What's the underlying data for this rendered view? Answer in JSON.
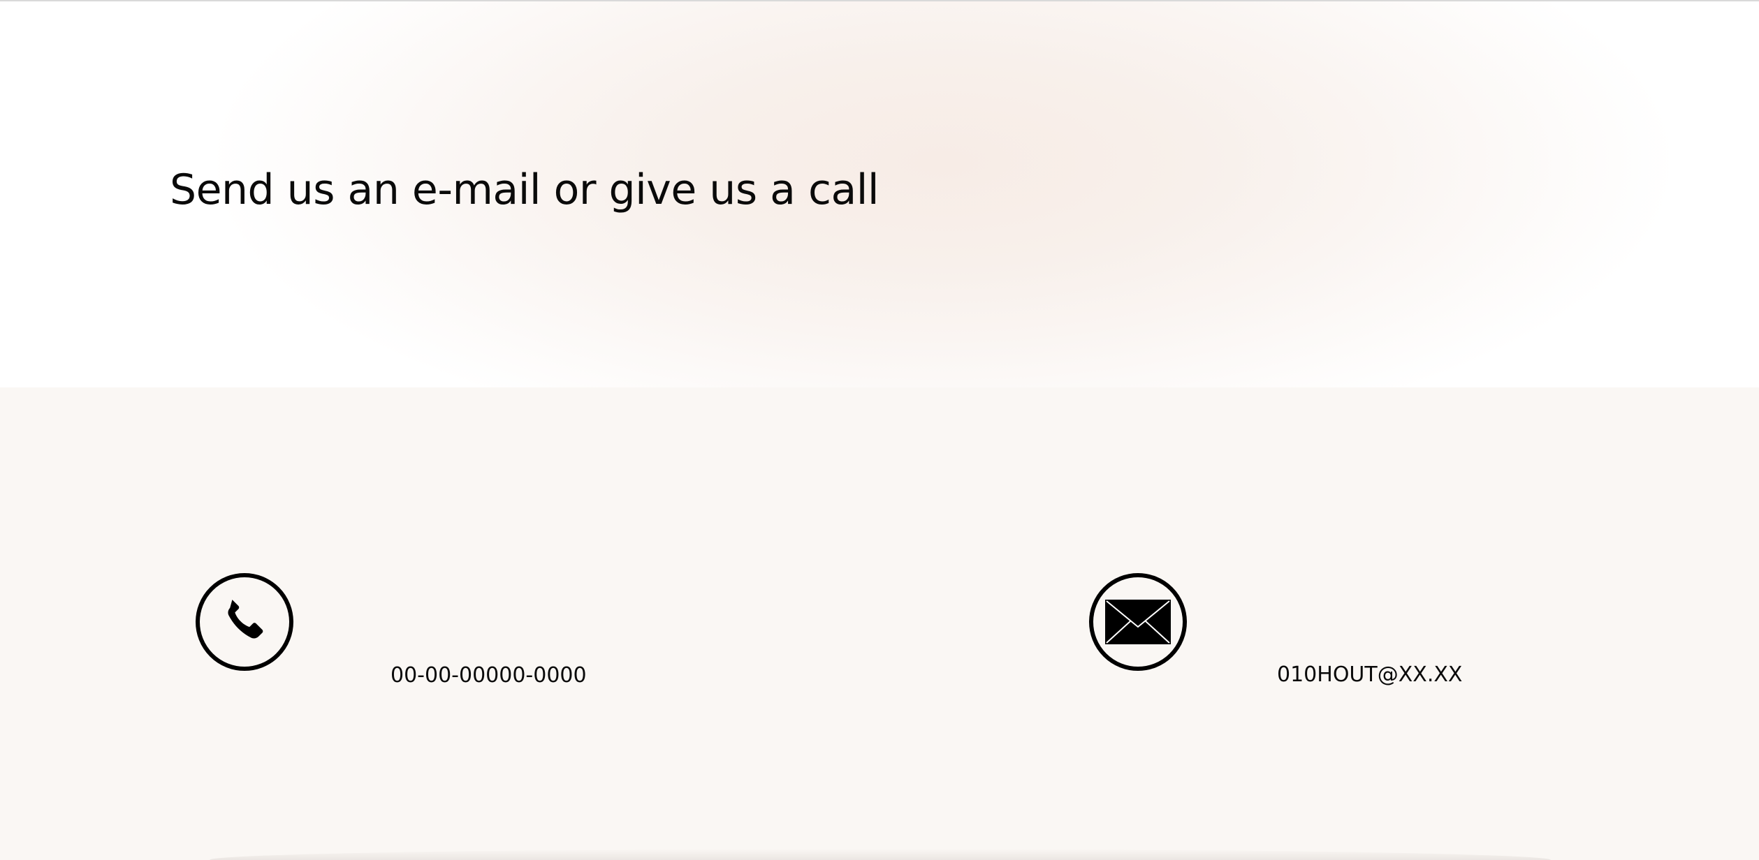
{
  "hero": {
    "title": "Send us an e-mail or give us a call"
  },
  "contact": {
    "phone": {
      "icon": "phone-icon",
      "number": "00-00-00000-0000"
    },
    "email": {
      "icon": "envelope-icon",
      "address": "010HOUT@XX.XX"
    }
  },
  "colors": {
    "hero_glow": "#f7ece6",
    "section_bg": "#faf7f4",
    "text": "#0a0a0a"
  }
}
